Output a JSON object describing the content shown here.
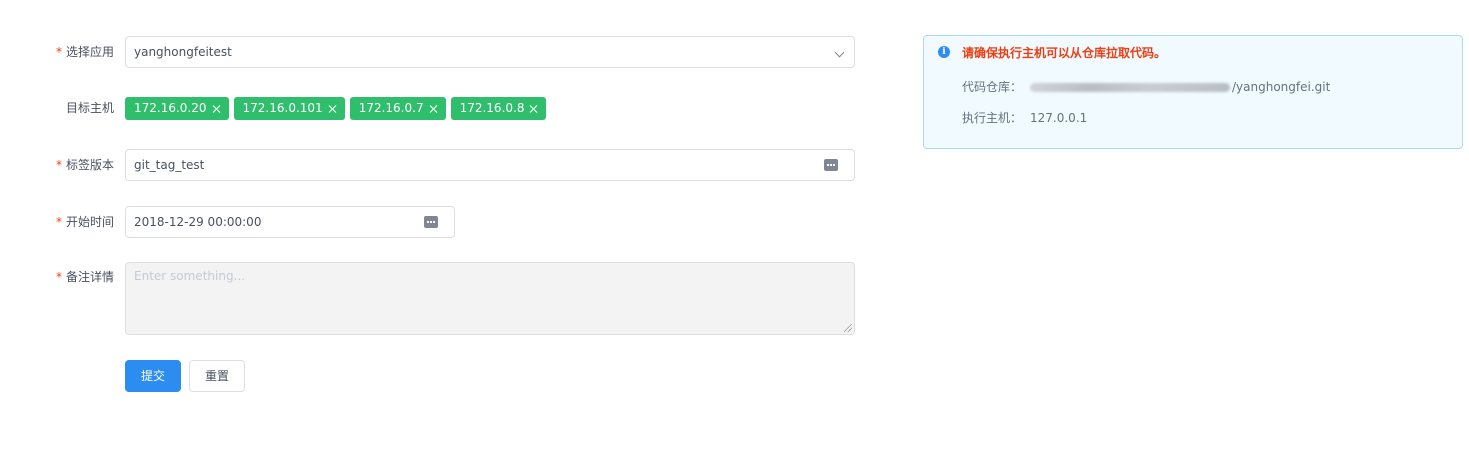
{
  "form": {
    "app": {
      "label": "选择应用",
      "value": "yanghongfeitest"
    },
    "hosts": {
      "label": "目标主机",
      "tags": [
        "172.16.0.20",
        "172.16.0.101",
        "172.16.0.7",
        "172.16.0.8"
      ]
    },
    "tag_version": {
      "label": "标签版本",
      "value": "git_tag_test"
    },
    "start_time": {
      "label": "开始时间",
      "value": "2018-12-29 00:00:00"
    },
    "remark": {
      "label": "备注详情",
      "placeholder": "Enter something..."
    },
    "submit_label": "提交",
    "reset_label": "重置"
  },
  "alert": {
    "title": "请确保执行主机可以从仓库拉取代码。",
    "repo_label": "代码仓库：",
    "repo_value": "/yanghongfei.git",
    "host_label": "执行主机：",
    "host_value": "127.0.0.1"
  },
  "colors": {
    "tag": "#2fbf6c",
    "primary": "#2d8cf0",
    "required": "#ed3f14",
    "alert_bg": "#f0faff",
    "alert_border": "#abdcff"
  }
}
